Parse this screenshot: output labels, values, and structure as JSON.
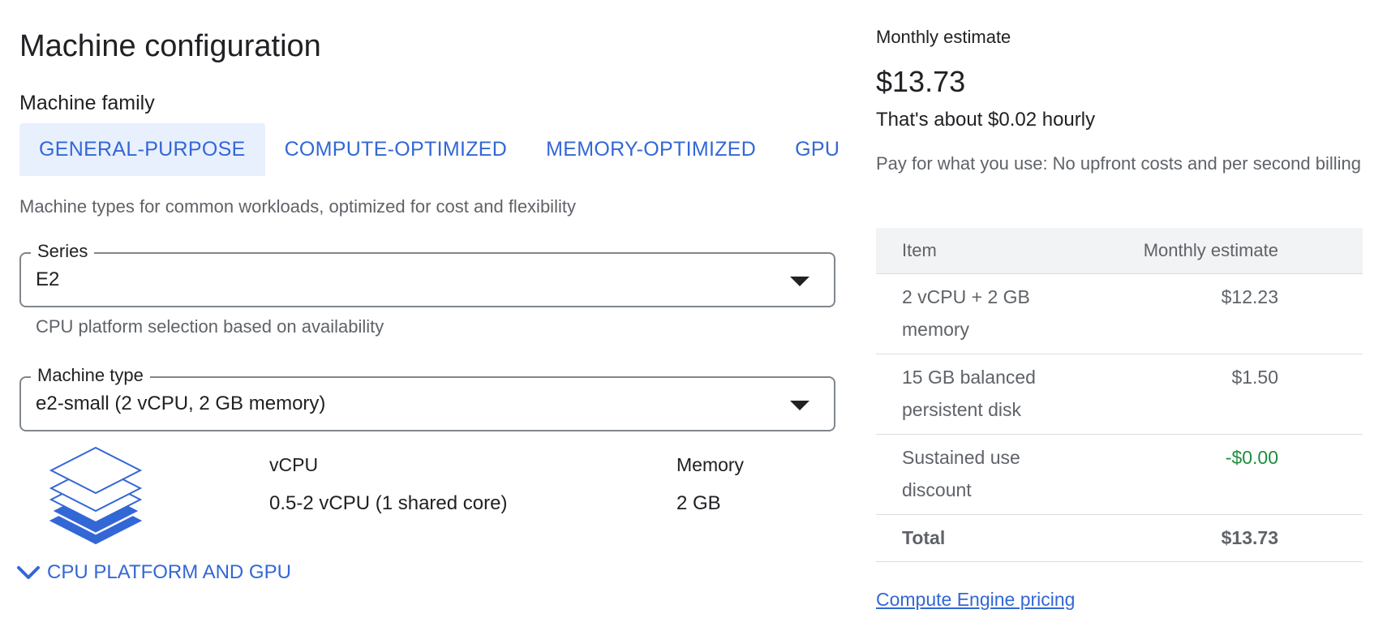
{
  "config": {
    "title": "Machine configuration",
    "family_label": "Machine family",
    "tabs": [
      {
        "label": "GENERAL-PURPOSE",
        "active": true
      },
      {
        "label": "COMPUTE-OPTIMIZED",
        "active": false
      },
      {
        "label": "MEMORY-OPTIMIZED",
        "active": false
      },
      {
        "label": "GPU",
        "active": false
      }
    ],
    "family_description": "Machine types for common workloads, optimized for cost and flexibility",
    "series": {
      "label": "Series",
      "value": "E2",
      "hint": "CPU platform selection based on availability"
    },
    "machine_type": {
      "label": "Machine type",
      "value": "e2-small (2 vCPU, 2 GB memory)"
    },
    "specs": {
      "vcpu_label": "vCPU",
      "vcpu_value": "0.5-2 vCPU (1 shared core)",
      "memory_label": "Memory",
      "memory_value": "2 GB"
    },
    "expander_label": "CPU PLATFORM AND GPU"
  },
  "estimate": {
    "label": "Monthly estimate",
    "price": "$13.73",
    "hourly": "That's about $0.02 hourly",
    "note": "Pay for what you use: No upfront costs and per second billing",
    "table": {
      "headers": {
        "item": "Item",
        "cost": "Monthly estimate"
      },
      "rows": [
        {
          "item": "2 vCPU + 2 GB memory",
          "cost": "$12.23"
        },
        {
          "item": "15 GB balanced persistent disk",
          "cost": "$1.50"
        },
        {
          "item": "Sustained use discount",
          "cost": "-$0.00"
        }
      ],
      "total": {
        "item": "Total",
        "cost": "$13.73"
      }
    },
    "pricing_link": "Compute Engine pricing"
  },
  "colors": {
    "accent": "#3367d6",
    "tab_active_bg": "#e8f0fe",
    "discount": "#1e8e3e",
    "table_head_bg": "#f1f3f4"
  },
  "icons": {
    "stack": "layers-stack-icon",
    "expander": "chevron-down-icon",
    "caret": "dropdown-caret-icon"
  }
}
